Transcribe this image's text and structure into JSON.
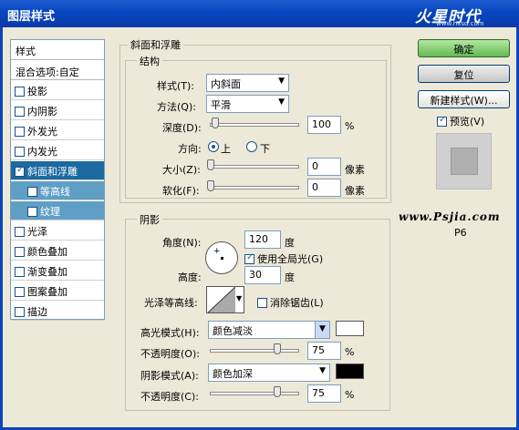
{
  "window": {
    "title": "图层样式"
  },
  "brand": {
    "name": "火星时代",
    "sub": "www.hxsd.com"
  },
  "sidebar": {
    "header": "样式",
    "blend_options": "混合选项:自定",
    "items": [
      {
        "label": "投影",
        "checked": false
      },
      {
        "label": "内阴影",
        "checked": false
      },
      {
        "label": "外发光",
        "checked": false
      },
      {
        "label": "内发光",
        "checked": false
      },
      {
        "label": "斜面和浮雕",
        "checked": true
      },
      {
        "label": "等高线",
        "checked": false
      },
      {
        "label": "纹理",
        "checked": false
      },
      {
        "label": "光泽",
        "checked": false
      },
      {
        "label": "颜色叠加",
        "checked": false
      },
      {
        "label": "渐变叠加",
        "checked": false
      },
      {
        "label": "图案叠加",
        "checked": false
      },
      {
        "label": "描边",
        "checked": false
      }
    ]
  },
  "bevel": {
    "title": "斜面和浮雕",
    "structure": {
      "title": "结构",
      "style_label": "样式(T):",
      "style_value": "内斜面",
      "technique_label": "方法(Q):",
      "technique_value": "平滑",
      "depth_label": "深度(D):",
      "depth_value": "100",
      "depth_unit": "%",
      "depth_level": 0.05,
      "direction_label": "方向:",
      "dir_up": "上",
      "dir_down": "下",
      "size_label": "大小(Z):",
      "size_value": "0",
      "size_unit": "像素",
      "soften_label": "软化(F):",
      "soften_value": "0",
      "soften_unit": "像素"
    },
    "shading": {
      "title": "阴影",
      "angle_label": "角度(N):",
      "angle_value": "120",
      "angle_unit": "度",
      "global_light_label": "使用全局光(G)",
      "global_light_checked": true,
      "altitude_label": "高度:",
      "altitude_value": "30",
      "altitude_unit": "度",
      "gloss_label": "光泽等高线:",
      "antialias_label": "消除锯齿(L)",
      "highlight_mode_label": "高光模式(H):",
      "highlight_mode_value": "颜色减淡",
      "highlight_color": "#ffffff",
      "highlight_opacity_label": "不透明度(O):",
      "highlight_opacity_value": "75",
      "shadow_mode_label": "阴影模式(A):",
      "shadow_mode_value": "颜色加深",
      "shadow_color": "#000000",
      "shadow_opacity_label": "不透明度(C):",
      "shadow_opacity_value": "75",
      "percent": "%"
    }
  },
  "buttons": {
    "ok": "确定",
    "reset": "复位",
    "new_style": "新建样式(W)...",
    "preview": "预览(V)",
    "preview_checked": true
  },
  "watermark": {
    "url": "www.Psjia.com",
    "code": "P6"
  }
}
